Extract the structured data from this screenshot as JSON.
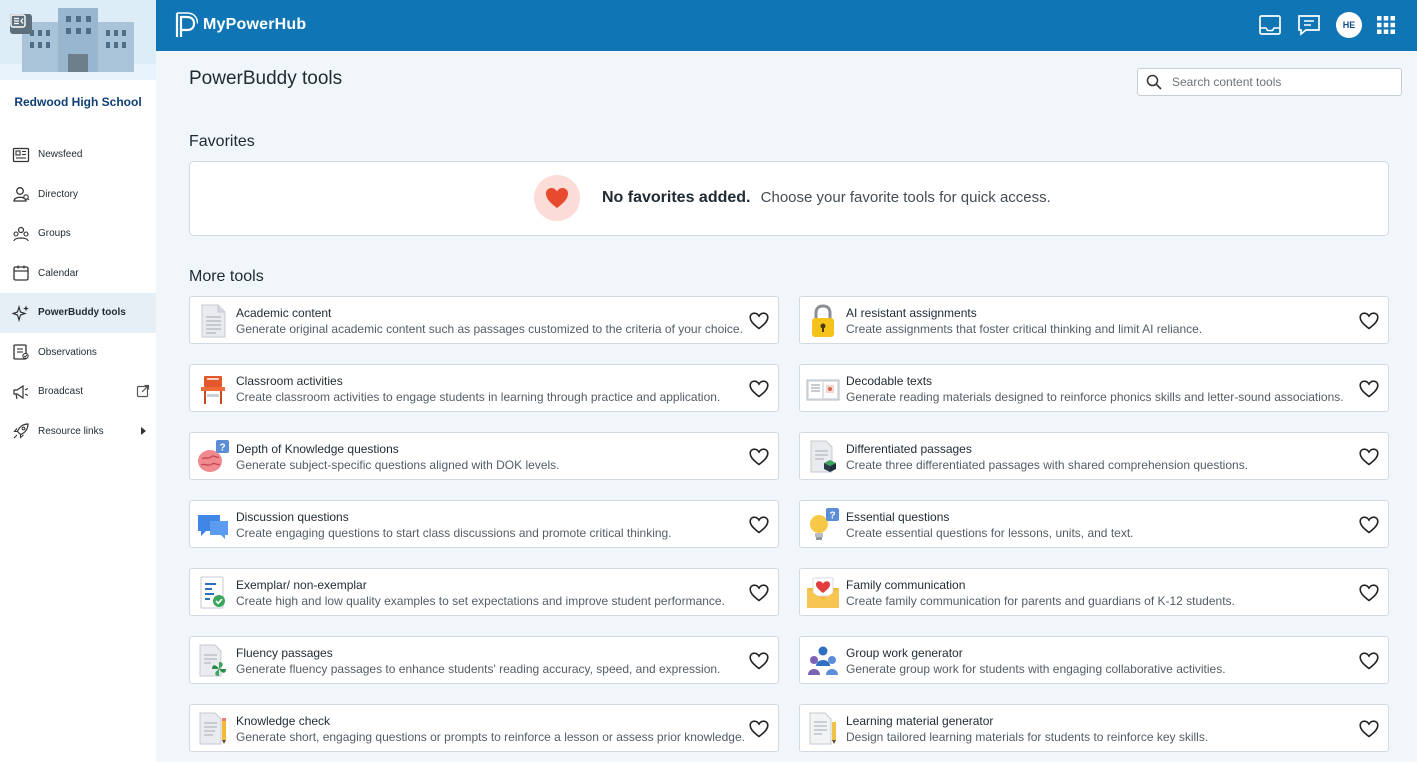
{
  "app": {
    "brand": "MyPowerHub",
    "user_initials": "HE"
  },
  "sidebar": {
    "school_name": "Redwood High School",
    "items": [
      {
        "label": "Newsfeed",
        "icon": "newsfeed-icon"
      },
      {
        "label": "Directory",
        "icon": "directory-icon"
      },
      {
        "label": "Groups",
        "icon": "groups-icon"
      },
      {
        "label": "Calendar",
        "icon": "calendar-icon"
      },
      {
        "label": "PowerBuddy tools",
        "icon": "sparkle-icon",
        "active": true
      },
      {
        "label": "Observations",
        "icon": "observations-icon"
      },
      {
        "label": "Broadcast",
        "icon": "megaphone-icon"
      },
      {
        "label": "Resource links",
        "icon": "rocket-icon"
      }
    ]
  },
  "main": {
    "title": "PowerBuddy tools",
    "search_placeholder": "Search content tools",
    "favorites": {
      "heading": "Favorites",
      "empty_title": "No favorites added.",
      "empty_text": "Choose your favorite tools for quick access."
    },
    "more_tools_heading": "More tools",
    "tools": [
      {
        "title": "Academic content",
        "desc": "Generate original academic content such as passages customized to the criteria of your choice.",
        "icon": "document-icon"
      },
      {
        "title": "AI resistant assignments",
        "desc": "Create assignments that foster critical thinking and limit AI reliance.",
        "icon": "padlock-icon"
      },
      {
        "title": "Classroom activities",
        "desc": "Create classroom activities to engage students in learning through practice and application.",
        "icon": "desk-chair-icon"
      },
      {
        "title": "Decodable texts",
        "desc": "Generate reading materials designed to reinforce phonics skills and letter-sound associations.",
        "icon": "open-book-icon"
      },
      {
        "title": "Depth of Knowledge questions",
        "desc": "Generate subject-specific questions aligned with DOK levels.",
        "icon": "brain-question-icon"
      },
      {
        "title": "Differentiated passages",
        "desc": "Create three differentiated passages with shared comprehension questions.",
        "icon": "layered-document-icon"
      },
      {
        "title": "Discussion questions",
        "desc": "Create engaging questions to start class discussions and promote critical thinking.",
        "icon": "speech-bubbles-icon"
      },
      {
        "title": "Essential questions",
        "desc": "Create essential questions for lessons, units, and text.",
        "icon": "lightbulb-question-icon"
      },
      {
        "title": "Exemplar/ non-exemplar",
        "desc": "Create high and low quality examples to set expectations and improve student performance.",
        "icon": "checklist-icon"
      },
      {
        "title": "Family communication",
        "desc": "Create family communication for parents and guardians of K-12 students.",
        "icon": "heart-envelope-icon"
      },
      {
        "title": "Fluency passages",
        "desc": "Generate fluency passages to enhance students' reading accuracy, speed, and expression.",
        "icon": "pinwheel-document-icon"
      },
      {
        "title": "Group work generator",
        "desc": "Generate group work for students with engaging collaborative activities.",
        "icon": "people-group-icon"
      },
      {
        "title": "Knowledge check",
        "desc": "Generate short, engaging questions or prompts to reinforce a lesson or assess prior knowledge.",
        "icon": "pencil-document-icon"
      },
      {
        "title": "Learning material generator",
        "desc": "Design tailored learning materials for students to reinforce key skills.",
        "icon": "notes-pencil-icon"
      }
    ]
  },
  "colors": {
    "header": "#0f75b5",
    "sidebar_active": "#e6eef6",
    "heart": "#e84a2f",
    "heart_bg": "#fbdcd6"
  }
}
